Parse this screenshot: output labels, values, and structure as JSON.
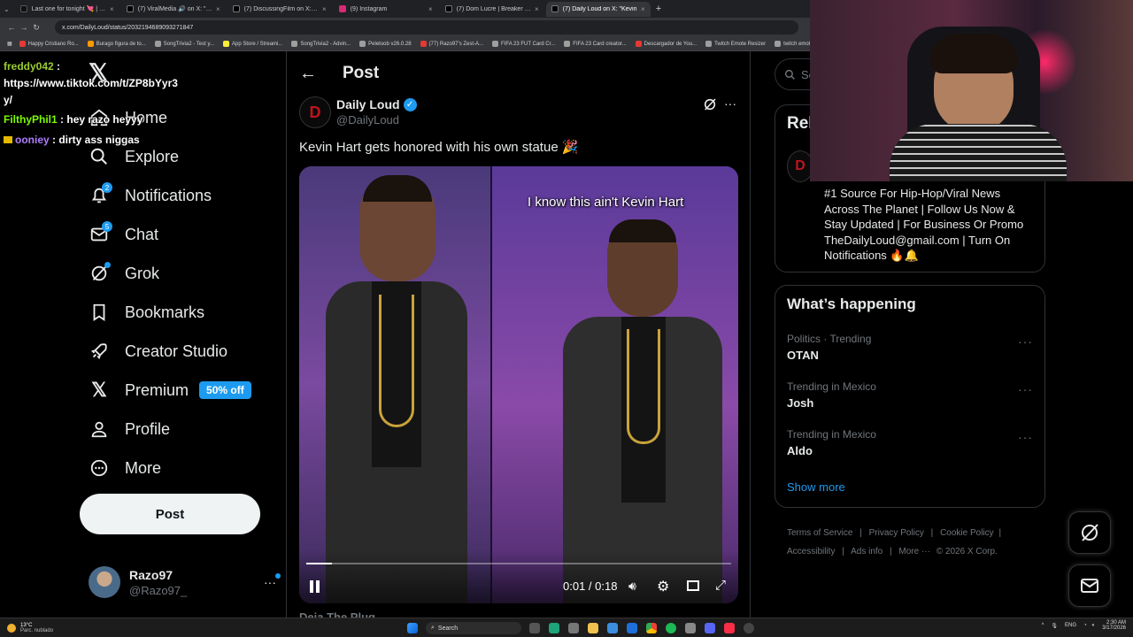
{
  "browser": {
    "tabs": [
      {
        "title": "Last one for tonight 💘 | TikTok",
        "color": "#111111"
      },
      {
        "title": "(7) ViralMedia 🔊 on X: \"Gentle",
        "color": "#000000"
      },
      {
        "title": "(7) DiscussingFilm on X: \"All c",
        "color": "#000000"
      },
      {
        "title": "(9) Instagram",
        "color": "#d62976"
      },
      {
        "title": "(7) Dom Lucre | Breaker of Nar",
        "color": "#000000"
      },
      {
        "title": "(7) Daily Loud on X: \"Kevin ",
        "color": "#000000",
        "active": true
      }
    ],
    "new_tab": "+",
    "url": "x.com/DailyLoud/status/2032194689093271847",
    "bookmarks": [
      {
        "label": "Happy Cristiano Ro...",
        "color": "#e53935"
      },
      {
        "label": "Burago figura de to...",
        "color": "#ff9800"
      },
      {
        "label": "SongTrivia2 - Test y...",
        "color": "#9e9e9e"
      },
      {
        "label": "App Store / Streami...",
        "color": "#ffeb3b"
      },
      {
        "label": "SongTrivia2 - Advin...",
        "color": "#9e9e9e"
      },
      {
        "label": "Peletoob v26.0.28",
        "color": "#9e9e9e"
      },
      {
        "label": "(77) Razo97's Zest-A...",
        "color": "#e53935"
      },
      {
        "label": "FIFA 23 FUT Card Cr...",
        "color": "#9e9e9e"
      },
      {
        "label": "FIFA 23 Card creator...",
        "color": "#9e9e9e"
      },
      {
        "label": "Descargador de You...",
        "color": "#e53935"
      },
      {
        "label": "Twitch Emote Resizer",
        "color": "#9e9e9e"
      },
      {
        "label": "twitch emote re...",
        "color": "#9e9e9e"
      }
    ]
  },
  "chat": [
    {
      "user": "freddy042",
      "user_color": "#9acd32",
      "message": ":"
    },
    {
      "user": "",
      "message": "https://www.tiktok.com/t/ZP8bYyr3"
    },
    {
      "user": "",
      "message": "y/"
    },
    {
      "user": "FilthyPhil1",
      "user_color": "#7cfc00",
      "message": ": hey razo heyyy"
    },
    {
      "user": "ooniey",
      "user_color": "#b07cff",
      "message": ": dirty ass niggas"
    }
  ],
  "sidebar": {
    "items": [
      {
        "label": "Home",
        "icon": "home-icon"
      },
      {
        "label": "Explore",
        "icon": "search-icon"
      },
      {
        "label": "Notifications",
        "icon": "bell-icon",
        "badge": "2"
      },
      {
        "label": "Chat",
        "icon": "mail-icon",
        "badge": "5"
      },
      {
        "label": "Grok",
        "icon": "grok-icon"
      },
      {
        "label": "Bookmarks",
        "icon": "bookmark-icon"
      },
      {
        "label": "Creator Studio",
        "icon": "rocket-icon"
      },
      {
        "label": "Premium",
        "icon": "x-logo-icon",
        "tag": "50% off"
      },
      {
        "label": "Profile",
        "icon": "person-icon"
      },
      {
        "label": "More",
        "icon": "more-circle-icon"
      }
    ],
    "post_button": "Post",
    "account": {
      "name": "Razo97",
      "handle": "@Razo97_"
    }
  },
  "post": {
    "header_title": "Post",
    "author_name": "Daily Loud",
    "author_handle": "@DailyLoud",
    "text": "Kevin Hart gets honored with his own statue 🎉",
    "video": {
      "overlay_text": "I know this ain't Kevin Hart",
      "time": "0:01 / 0:18",
      "progress": 0.06
    },
    "next_author": "Deja The Plug"
  },
  "right": {
    "search_placeholder": "Se",
    "relevant_title": "Rel",
    "bio": "#1 Source For Hip-Hop/Viral News Across The Planet | Follow Us Now & Stay Updated | For Business Or Promo TheDailyLoud@gmail.com | Turn On Notifications 🔥🔔",
    "happening_title": "What’s happening",
    "trends": [
      {
        "context": "Politics · Trending",
        "name": "OTAN"
      },
      {
        "context": "Trending in Mexico",
        "name": "Josh"
      },
      {
        "context": "Trending in Mexico",
        "name": "Aldo"
      }
    ],
    "show_more": "Show more",
    "footer": [
      "Terms of Service",
      "Privacy Policy",
      "Cookie Policy",
      "Accessibility",
      "Ads info",
      "More ···",
      "© 2026 X Corp."
    ]
  },
  "taskbar": {
    "weather_temp": "13°C",
    "weather_desc": "Parc. nublado",
    "search": "Search",
    "lang": "ENG",
    "time": "2:30 AM",
    "date": "3/17/2026"
  }
}
